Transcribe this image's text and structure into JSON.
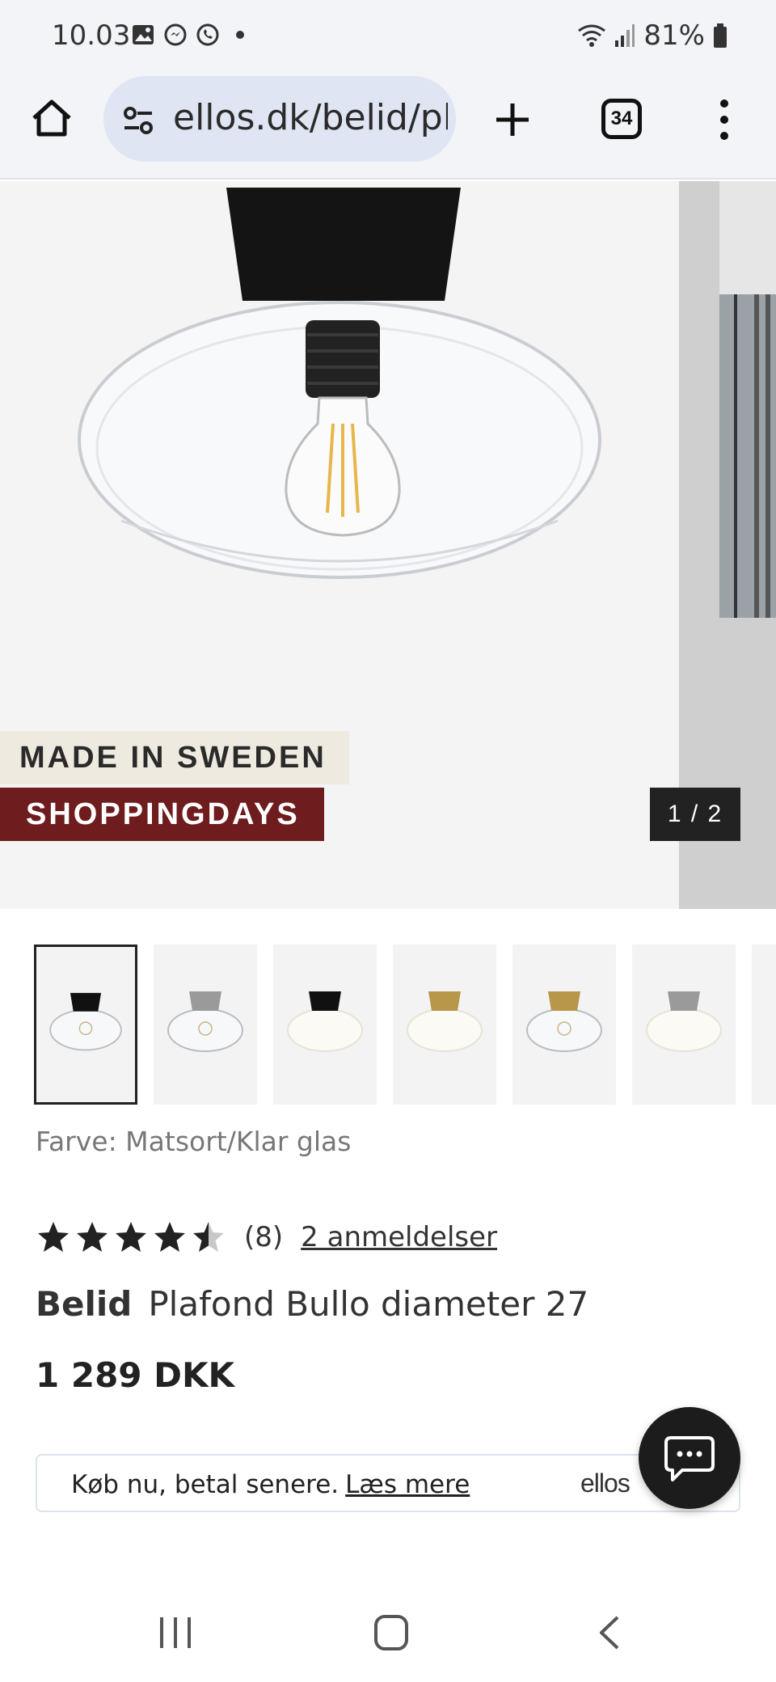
{
  "status_bar": {
    "time": "10.03",
    "battery": "81%",
    "icons": [
      "gallery-icon",
      "messenger-icon",
      "whatsapp-icon",
      "dot-icon",
      "wifi-icon",
      "signal-icon",
      "battery-icon"
    ]
  },
  "browser": {
    "url": "ellos.dk/belid/pla",
    "tab_count": "34",
    "icons": [
      "home-icon",
      "site-settings-icon",
      "new-tab-icon",
      "tabs-icon",
      "more-icon"
    ]
  },
  "hero": {
    "badge_origin": "MADE IN SWEDEN",
    "badge_campaign": "SHOPPINGDAYS",
    "counter": "1 / 2",
    "colors": {
      "origin_bg": "#efeae0",
      "campaign_bg": "#6e1c1d"
    }
  },
  "thumbnails": [
    {
      "cap": "#111111",
      "shade": "clear",
      "selected": true
    },
    {
      "cap": "#9a9a9a",
      "shade": "clear",
      "selected": false
    },
    {
      "cap": "#111111",
      "shade": "opal",
      "selected": false
    },
    {
      "cap": "#b8964a",
      "shade": "opal",
      "selected": false
    },
    {
      "cap": "#b8964a",
      "shade": "clear",
      "selected": false
    },
    {
      "cap": "#9a9a9a",
      "shade": "opal",
      "selected": false
    }
  ],
  "product": {
    "color_label": "Farve: Matsort/Klar glas",
    "rating": 4.5,
    "rating_max": 5,
    "rating_count": "(8)",
    "reviews_link": "2 anmeldelser",
    "brand": "Belid",
    "name": "Plafond Bullo diameter 27",
    "price": "1 289 DKK"
  },
  "payment": {
    "text": "Køb nu, betal senere.",
    "link": "Læs mere",
    "logo": "ellos"
  },
  "nav": {
    "icons": [
      "recents-icon",
      "home-nav-icon",
      "back-icon"
    ]
  }
}
